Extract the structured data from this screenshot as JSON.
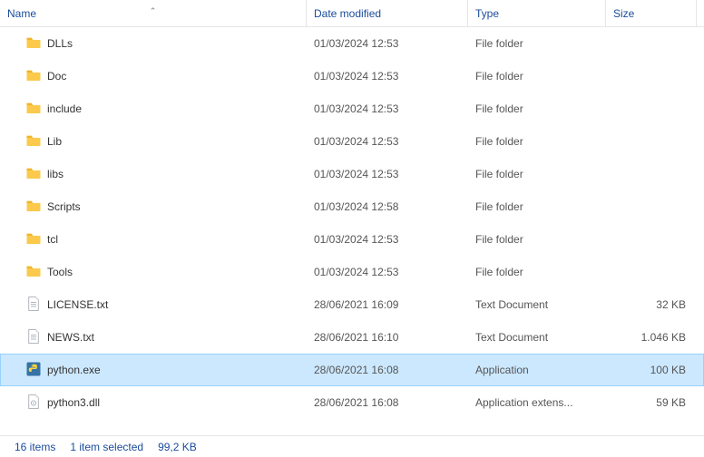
{
  "columns": {
    "name": "Name",
    "date": "Date modified",
    "type": "Type",
    "size": "Size"
  },
  "sort_column": "name",
  "sort_direction": "asc",
  "items": [
    {
      "icon": "folder",
      "name": "DLLs",
      "date": "01/03/2024 12:53",
      "type": "File folder",
      "size": ""
    },
    {
      "icon": "folder",
      "name": "Doc",
      "date": "01/03/2024 12:53",
      "type": "File folder",
      "size": ""
    },
    {
      "icon": "folder",
      "name": "include",
      "date": "01/03/2024 12:53",
      "type": "File folder",
      "size": ""
    },
    {
      "icon": "folder",
      "name": "Lib",
      "date": "01/03/2024 12:53",
      "type": "File folder",
      "size": ""
    },
    {
      "icon": "folder",
      "name": "libs",
      "date": "01/03/2024 12:53",
      "type": "File folder",
      "size": ""
    },
    {
      "icon": "folder",
      "name": "Scripts",
      "date": "01/03/2024 12:58",
      "type": "File folder",
      "size": ""
    },
    {
      "icon": "folder",
      "name": "tcl",
      "date": "01/03/2024 12:53",
      "type": "File folder",
      "size": ""
    },
    {
      "icon": "folder",
      "name": "Tools",
      "date": "01/03/2024 12:53",
      "type": "File folder",
      "size": ""
    },
    {
      "icon": "txt",
      "name": "LICENSE.txt",
      "date": "28/06/2021 16:09",
      "type": "Text Document",
      "size": "32 KB"
    },
    {
      "icon": "txt",
      "name": "NEWS.txt",
      "date": "28/06/2021 16:10",
      "type": "Text Document",
      "size": "1.046 KB"
    },
    {
      "icon": "python",
      "name": "python.exe",
      "date": "28/06/2021 16:08",
      "type": "Application",
      "size": "100 KB",
      "selected": true
    },
    {
      "icon": "dll",
      "name": "python3.dll",
      "date": "28/06/2021 16:08",
      "type": "Application extens...",
      "size": "59 KB"
    }
  ],
  "status": {
    "item_count": "16 items",
    "selected": "1 item selected",
    "selection_size": "99,2 KB"
  }
}
